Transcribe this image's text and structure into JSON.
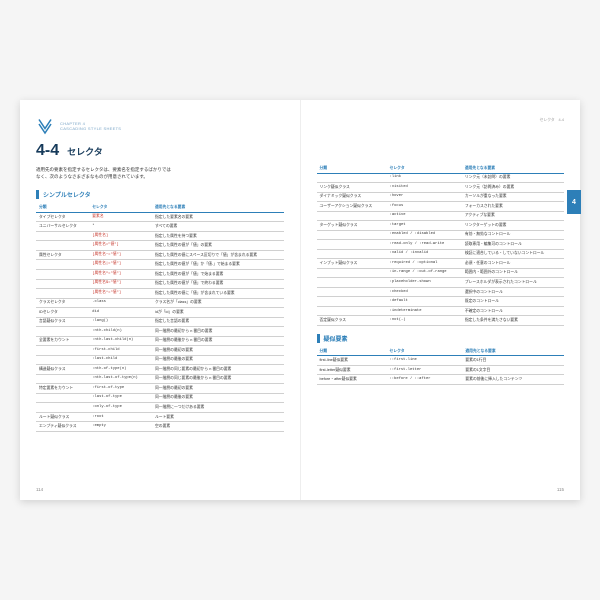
{
  "chapter": {
    "label_line1": "CHAPTER 4",
    "label_line2": "CASCADING STYLE SHEETS"
  },
  "title": {
    "number": "4-4",
    "text": "セレクタ"
  },
  "intro": "適用先の要素を指定するセレクタは、要素名を指定するばかりではなく、次のようなさまざまなものが用意されています。",
  "tab": "4",
  "crumb": "セレクタ　4-4",
  "page_left": "114",
  "page_right": "115",
  "sections": {
    "simple": "シンプルセレクタ",
    "pseudo": "疑似要素"
  },
  "headers": {
    "cat": "分類",
    "sel": "セレクタ",
    "desc": "適用先となる要素"
  },
  "left_rows": [
    {
      "cat": "タイプセレクタ",
      "sel": "要素名",
      "red": true,
      "desc": "指定した要素名の要素"
    },
    {
      "cat": "ユニバーサルセレクタ",
      "sel": "*",
      "desc": "すべての要素"
    },
    {
      "cat": "",
      "sel": "[属性名]",
      "red": true,
      "desc": "指定した属性を持つ要素"
    },
    {
      "cat": "",
      "sel": "[属性名=\"値\"]",
      "red": true,
      "desc": "指定した属性の値が「値」の要素"
    },
    {
      "cat": "属性セレクタ",
      "sel": "[属性名~=\"値\"]",
      "red": true,
      "desc": "指定した属性の値にスペース区切りで「値」が含まれる要素"
    },
    {
      "cat": "",
      "sel": "[属性名|=\"値\"]",
      "red": true,
      "desc": "指定した属性の値が「値」か「値-」で始まる要素"
    },
    {
      "cat": "",
      "sel": "[属性名^=\"値\"]",
      "red": true,
      "desc": "指定した属性の値が「値」で始まる要素"
    },
    {
      "cat": "",
      "sel": "[属性名$=\"値\"]",
      "red": true,
      "desc": "指定した属性の値が「値」で終わる要素"
    },
    {
      "cat": "",
      "sel": "[属性名*=\"値\"]",
      "red": true,
      "desc": "指定した属性の値に「値」が含まれている要素"
    },
    {
      "cat": "クラスセレクタ",
      "sel": ".class",
      "desc": "クラス名が「class」の要素"
    },
    {
      "cat": "IDセレクタ",
      "sel": "#id",
      "desc": "idが「id」の要素"
    },
    {
      "cat": "言語疑似クラス",
      "sel": ":lang()",
      "desc": "指定した言語の要素"
    },
    {
      "cat": "",
      "sel": ":nth-child(n)",
      "desc": "同一階層の最初から n 番目の要素"
    },
    {
      "cat": "全要素をカウント",
      "sel": ":nth-last-child(n)",
      "desc": "同一階層の最後から n 番目の要素"
    },
    {
      "cat": "",
      "sel": ":first-child",
      "desc": "同一階層の最初の要素"
    },
    {
      "cat": "",
      "sel": ":last-child",
      "desc": "同一階層の最後の要素"
    },
    {
      "cat": "構造疑似クラス",
      "sel": ":nth-of-type(n)",
      "desc": "同一階層の同じ要素の最初から n 番目の要素"
    },
    {
      "cat": "",
      "sel": ":nth-last-of-type(n)",
      "desc": "同一階層の同じ要素の最後から n 番目の要素"
    },
    {
      "cat": "特定要素をカウント",
      "sel": ":first-of-type",
      "desc": "同一階層の最初の要素"
    },
    {
      "cat": "",
      "sel": ":last-of-type",
      "desc": "同一階層の最後の要素"
    },
    {
      "cat": "",
      "sel": ":only-of-type",
      "desc": "同一階層に一つだけある要素"
    },
    {
      "cat": "ルート疑似クラス",
      "sel": ":root",
      "desc": "ルート要素"
    },
    {
      "cat": "エンプティ疑似クラス",
      "sel": ":empty",
      "desc": "空の要素"
    }
  ],
  "right_rows": [
    {
      "cat": "",
      "sel": ":link",
      "desc": "リンク元（未訪問）の要素"
    },
    {
      "cat": "リンク疑似クラス",
      "sel": ":visited",
      "desc": "リンク元（訪問済み）の要素"
    },
    {
      "cat": "ダイナミック疑似クラス",
      "sel": ":hover",
      "desc": "カーソルが重なった要素"
    },
    {
      "cat": "ユーザーアクション疑似クラス",
      "sel": ":focus",
      "desc": "フォーカスされた要素"
    },
    {
      "cat": "",
      "sel": ":active",
      "desc": "アクティブな要素"
    },
    {
      "cat": "ターゲット疑似クラス",
      "sel": ":target",
      "desc": "リンクターゲットの要素"
    },
    {
      "cat": "",
      "sel": ":enabled / :disabled",
      "desc": "有効・無効なコントロール"
    },
    {
      "cat": "",
      "sel": ":read-only / :read-write",
      "desc": "読取専用・編集可のコントロール"
    },
    {
      "cat": "",
      "sel": ":valid / :invalid",
      "desc": "検証に適合している・していないコントロール"
    },
    {
      "cat": "インプット疑似クラス",
      "sel": ":required / :optional",
      "desc": "必須・任意のコントロール"
    },
    {
      "cat": "",
      "sel": ":in-range / :out-of-range",
      "desc": "範囲内・範囲外のコントロール"
    },
    {
      "cat": "",
      "sel": ":placeholder-shown",
      "desc": "プレースホルダが表示されたコントロール"
    },
    {
      "cat": "",
      "sel": ":checked",
      "desc": "選択中のコントロール"
    },
    {
      "cat": "",
      "sel": ":default",
      "desc": "既定のコントロール"
    },
    {
      "cat": "",
      "sel": ":indeterminate",
      "desc": "不確定のコントロール"
    },
    {
      "cat": "否定疑似クラス",
      "sel": ":not(…)",
      "desc": "指定した条件を満たさない要素"
    }
  ],
  "pseudo_rows": [
    {
      "cat": "first-line疑似要素",
      "sel": "::first-line",
      "desc": "要素の1行目"
    },
    {
      "cat": "first-letter疑似要素",
      "sel": "::first-letter",
      "desc": "要素の1文字目"
    },
    {
      "cat": "before・after疑似要素",
      "sel": "::before / ::after",
      "desc": "要素の前後に挿入したコンテンツ"
    }
  ]
}
